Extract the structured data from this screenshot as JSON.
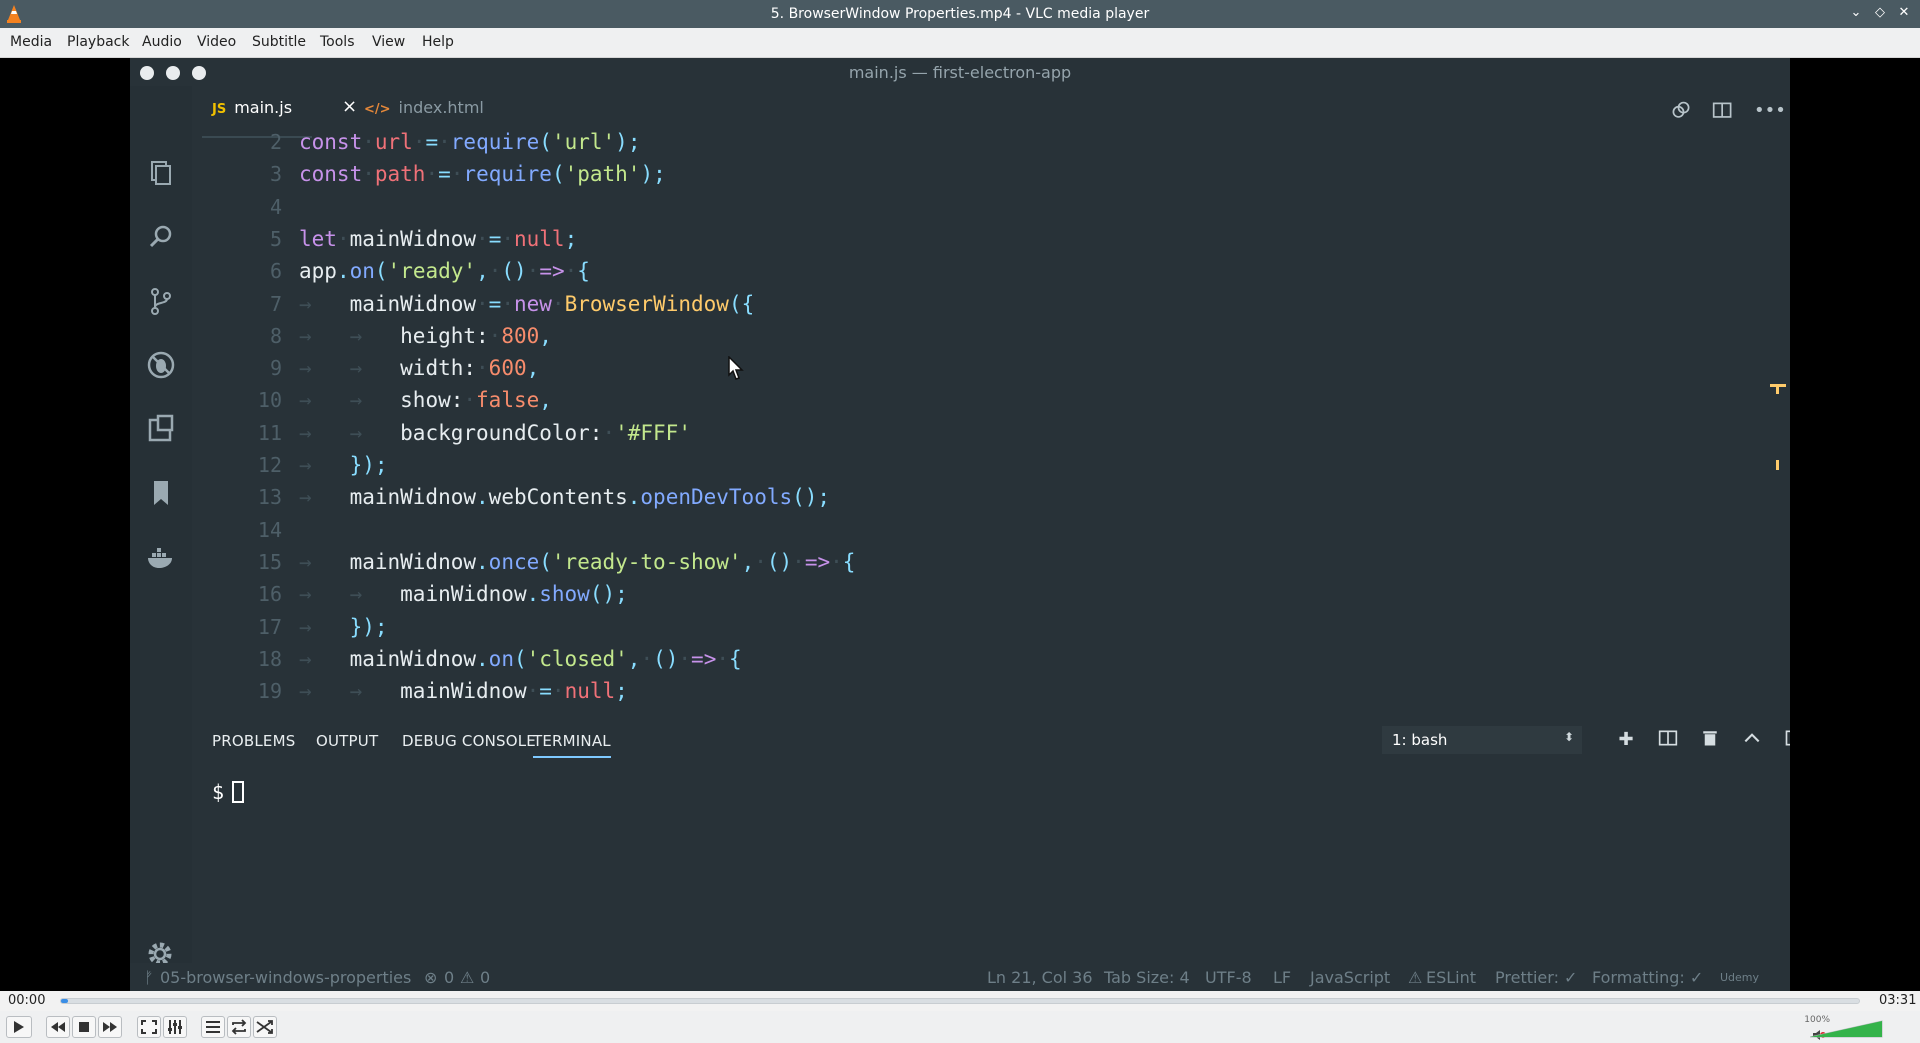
{
  "vlc": {
    "window_title": "5. BrowserWindow Properties.mp4 - VLC media player",
    "menu": [
      "Media",
      "Playback",
      "Audio",
      "Video",
      "Subtitle",
      "Tools",
      "View",
      "Help"
    ],
    "time_elapsed": "00:00",
    "time_total": "03:31",
    "progress_fraction": 0.003,
    "volume_label": "100%",
    "volume_level": 1.0
  },
  "vscode": {
    "window_title": "main.js — first-electron-app",
    "tabs": [
      {
        "lang": "JS",
        "label": "main.js",
        "active": true
      },
      {
        "lang": "</>",
        "label": "index.html",
        "active": false
      }
    ],
    "code_lines": [
      {
        "n": "2",
        "tokens": [
          [
            "kw",
            "const"
          ],
          [
            "dot",
            "·"
          ],
          [
            "var",
            "url"
          ],
          [
            "dot",
            "·"
          ],
          [
            "op",
            "="
          ],
          [
            "dot",
            "·"
          ],
          [
            "fn",
            "require"
          ],
          [
            "punc",
            "("
          ],
          [
            "str",
            "'url'"
          ],
          [
            "punc",
            ");"
          ]
        ]
      },
      {
        "n": "3",
        "tokens": [
          [
            "kw",
            "const"
          ],
          [
            "dot",
            "·"
          ],
          [
            "var",
            "path"
          ],
          [
            "dot",
            "·"
          ],
          [
            "op",
            "="
          ],
          [
            "dot",
            "·"
          ],
          [
            "fn",
            "require"
          ],
          [
            "punc",
            "("
          ],
          [
            "str",
            "'path'"
          ],
          [
            "punc",
            ");"
          ]
        ]
      },
      {
        "n": "4",
        "tokens": []
      },
      {
        "n": "5",
        "tokens": [
          [
            "kw",
            "let"
          ],
          [
            "dot",
            "·"
          ],
          [
            "def",
            "mainWidnow"
          ],
          [
            "dot",
            "·"
          ],
          [
            "op",
            "="
          ],
          [
            "dot",
            "·"
          ],
          [
            "var",
            "null"
          ],
          [
            "punc",
            ";"
          ]
        ]
      },
      {
        "n": "6",
        "tokens": [
          [
            "def",
            "app"
          ],
          [
            "punc",
            "."
          ],
          [
            "fn",
            "on"
          ],
          [
            "punc",
            "("
          ],
          [
            "str",
            "'ready'"
          ],
          [
            "punc",
            ","
          ],
          [
            "dot",
            "·"
          ],
          [
            "punc",
            "()"
          ],
          [
            "dot",
            "·"
          ],
          [
            "kw",
            "=>"
          ],
          [
            "dot",
            "·"
          ],
          [
            "punc",
            "{"
          ]
        ]
      },
      {
        "n": "7",
        "tokens": [
          [
            "arr",
            "→   "
          ],
          [
            "def",
            "mainWidnow"
          ],
          [
            "dot",
            "·"
          ],
          [
            "op",
            "="
          ],
          [
            "dot",
            "·"
          ],
          [
            "kw",
            "new"
          ],
          [
            "dot",
            "·"
          ],
          [
            "cls",
            "BrowserWindow"
          ],
          [
            "punc",
            "({"
          ]
        ]
      },
      {
        "n": "8",
        "tokens": [
          [
            "arr",
            "→   →   "
          ],
          [
            "def",
            "height:"
          ],
          [
            "dot",
            "·"
          ],
          [
            "num",
            "800"
          ],
          [
            "punc",
            ","
          ]
        ]
      },
      {
        "n": "9",
        "tokens": [
          [
            "arr",
            "→   →   "
          ],
          [
            "def",
            "width:"
          ],
          [
            "dot",
            "·"
          ],
          [
            "num",
            "600"
          ],
          [
            "punc",
            ","
          ]
        ]
      },
      {
        "n": "10",
        "tokens": [
          [
            "arr",
            "→   →   "
          ],
          [
            "def",
            "show:"
          ],
          [
            "dot",
            "·"
          ],
          [
            "num",
            "false"
          ],
          [
            "punc",
            ","
          ]
        ]
      },
      {
        "n": "11",
        "tokens": [
          [
            "arr",
            "→   →   "
          ],
          [
            "def",
            "backgroundColor:"
          ],
          [
            "dot",
            "·"
          ],
          [
            "str",
            "'#FFF'"
          ]
        ]
      },
      {
        "n": "12",
        "tokens": [
          [
            "arr",
            "→   "
          ],
          [
            "punc",
            "});"
          ]
        ]
      },
      {
        "n": "13",
        "tokens": [
          [
            "arr",
            "→   "
          ],
          [
            "def",
            "mainWidnow"
          ],
          [
            "punc",
            "."
          ],
          [
            "def",
            "webContents"
          ],
          [
            "punc",
            "."
          ],
          [
            "fn",
            "openDevTools"
          ],
          [
            "punc",
            "();"
          ]
        ]
      },
      {
        "n": "14",
        "tokens": []
      },
      {
        "n": "15",
        "tokens": [
          [
            "arr",
            "→   "
          ],
          [
            "def",
            "mainWidnow"
          ],
          [
            "punc",
            "."
          ],
          [
            "fn",
            "once"
          ],
          [
            "punc",
            "("
          ],
          [
            "str",
            "'ready-to-show'"
          ],
          [
            "punc",
            ","
          ],
          [
            "dot",
            "·"
          ],
          [
            "punc",
            "()"
          ],
          [
            "dot",
            "·"
          ],
          [
            "kw",
            "=>"
          ],
          [
            "dot",
            "·"
          ],
          [
            "punc",
            "{"
          ]
        ]
      },
      {
        "n": "16",
        "tokens": [
          [
            "arr",
            "→   →   "
          ],
          [
            "def",
            "mainWidnow"
          ],
          [
            "punc",
            "."
          ],
          [
            "fn",
            "show"
          ],
          [
            "punc",
            "();"
          ]
        ]
      },
      {
        "n": "17",
        "tokens": [
          [
            "arr",
            "→   "
          ],
          [
            "punc",
            "});"
          ]
        ]
      },
      {
        "n": "18",
        "tokens": [
          [
            "arr",
            "→   "
          ],
          [
            "def",
            "mainWidnow"
          ],
          [
            "punc",
            "."
          ],
          [
            "fn",
            "on"
          ],
          [
            "punc",
            "("
          ],
          [
            "str",
            "'closed'"
          ],
          [
            "punc",
            ","
          ],
          [
            "dot",
            "·"
          ],
          [
            "punc",
            "()"
          ],
          [
            "dot",
            "·"
          ],
          [
            "kw",
            "=>"
          ],
          [
            "dot",
            "·"
          ],
          [
            "punc",
            "{"
          ]
        ]
      },
      {
        "n": "19",
        "tokens": [
          [
            "arr",
            "→   →   "
          ],
          [
            "def",
            "mainWidnow"
          ],
          [
            "dot",
            "·"
          ],
          [
            "op",
            "="
          ],
          [
            "dot",
            "·"
          ],
          [
            "var",
            "null"
          ],
          [
            "punc",
            ";"
          ]
        ]
      }
    ],
    "panel_tabs": [
      "PROBLEMS",
      "OUTPUT",
      "DEBUG CONSOLE",
      "TERMINAL"
    ],
    "active_panel_tab": "TERMINAL",
    "terminal_select": "1: bash",
    "terminal_prompt": "$",
    "status": {
      "branch": "05-browser-windows-properties",
      "errors": "0",
      "warnings": "0",
      "position": "Ln 21, Col 36",
      "tab_size": "Tab Size: 4",
      "encoding": "UTF-8",
      "eol": "LF",
      "language": "JavaScript",
      "eslint": "ESLint",
      "prettier": "Prettier: ✓",
      "formatting": "Formatting: ✓",
      "udemy": "Udemy"
    }
  }
}
